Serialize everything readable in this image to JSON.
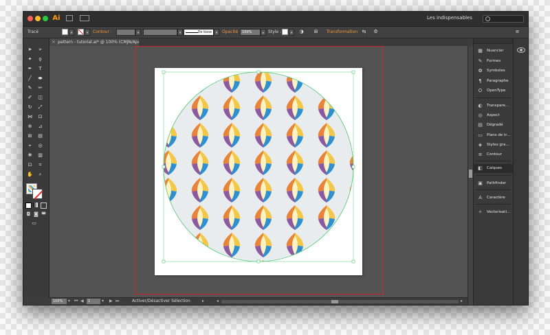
{
  "app": {
    "logo": "Ai",
    "workspace": "Les indispensables",
    "traffic_lights": [
      "close",
      "minimize",
      "zoom"
    ]
  },
  "control_bar": {
    "trace_label": "Tracé",
    "contour_label": "Contour :",
    "stroke_profile": "De base",
    "opacity_label": "Opacité :",
    "opacity_value": "100%",
    "style_label": "Style :",
    "transform_label": "Transformation"
  },
  "document": {
    "tab_title": "pattern - tutorial.ai* @ 100% (CMJN/Aperçu)"
  },
  "status_bar": {
    "zoom": "100%",
    "page": "1",
    "status_text": "Activer/Désactiver Sélection"
  },
  "right_panel": {
    "items": [
      {
        "label": "Nuancier",
        "icon": "swatches-icon"
      },
      {
        "label": "Formes",
        "icon": "brushes-icon"
      },
      {
        "label": "Symboles",
        "icon": "symbols-icon"
      },
      {
        "label": "Paragraphe",
        "icon": "paragraph-icon"
      },
      {
        "label": "OpenType",
        "icon": "opentype-icon"
      },
      {
        "label": "Transpare...",
        "icon": "transparency-icon"
      },
      {
        "label": "Aspect",
        "icon": "appearance-icon"
      },
      {
        "label": "Dégradé",
        "icon": "gradient-icon"
      },
      {
        "label": "Plans de tr...",
        "icon": "artboards-icon"
      },
      {
        "label": "Styles gra...",
        "icon": "graphic-styles-icon"
      },
      {
        "label": "Contour",
        "icon": "stroke-icon"
      },
      {
        "label": "Calques",
        "icon": "layers-icon"
      },
      {
        "label": "Pathfinder",
        "icon": "pathfinder-icon"
      },
      {
        "label": "Caractère",
        "icon": "character-icon"
      },
      {
        "label": "Vectorisati...",
        "icon": "image-trace-icon"
      }
    ]
  },
  "colors": {
    "accent": "#ff9a00",
    "bleed": "#c8262e",
    "pattern_yellow": "#f3c84a",
    "pattern_orange": "#e8833a",
    "pattern_purple": "#8d5aa0",
    "pattern_blue": "#2f8fcf",
    "pattern_cream": "#fff3c4",
    "pattern_bg": "#e8ecef",
    "selection": "#52c872"
  }
}
